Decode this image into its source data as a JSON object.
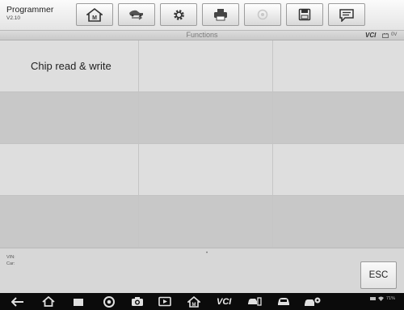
{
  "app": {
    "name": "Programmer",
    "version": "V2.10"
  },
  "toolbar": {
    "buttons": [
      {
        "name": "home",
        "icon": "home-icon"
      },
      {
        "name": "vehicle-swap",
        "icon": "vehicle-swap-icon"
      },
      {
        "name": "settings",
        "icon": "gear-icon"
      },
      {
        "name": "print",
        "icon": "printer-icon"
      },
      {
        "name": "help",
        "icon": "help-icon",
        "disabled": true
      },
      {
        "name": "save",
        "icon": "floppy-disk-icon"
      },
      {
        "name": "data-logging",
        "icon": "chat-bubble-icon"
      }
    ]
  },
  "status": {
    "section_title": "Functions",
    "vci_label": "VCI",
    "voltage": "0V"
  },
  "functions": [
    {
      "label": "Chip read & write"
    }
  ],
  "info": {
    "vin_label": "VIN:",
    "car_label": "Car:"
  },
  "esc_label": "ESC",
  "navbar": {
    "vci_label": "VCI",
    "system_status": "71%",
    "icons": [
      "back-icon",
      "home-icon",
      "recent-apps-icon",
      "chrome-icon",
      "camera-icon",
      "screen-record-icon",
      "maxisys-home-icon",
      "vci-icon",
      "car-diagnostic-icon",
      "car-icon",
      "car-settings-icon"
    ]
  },
  "colors": {
    "toolbar_bg": "#eeeeee",
    "grid_light": "#dedede",
    "grid_dark": "#c8c8c8",
    "navbar_bg": "#0b0b0b"
  }
}
